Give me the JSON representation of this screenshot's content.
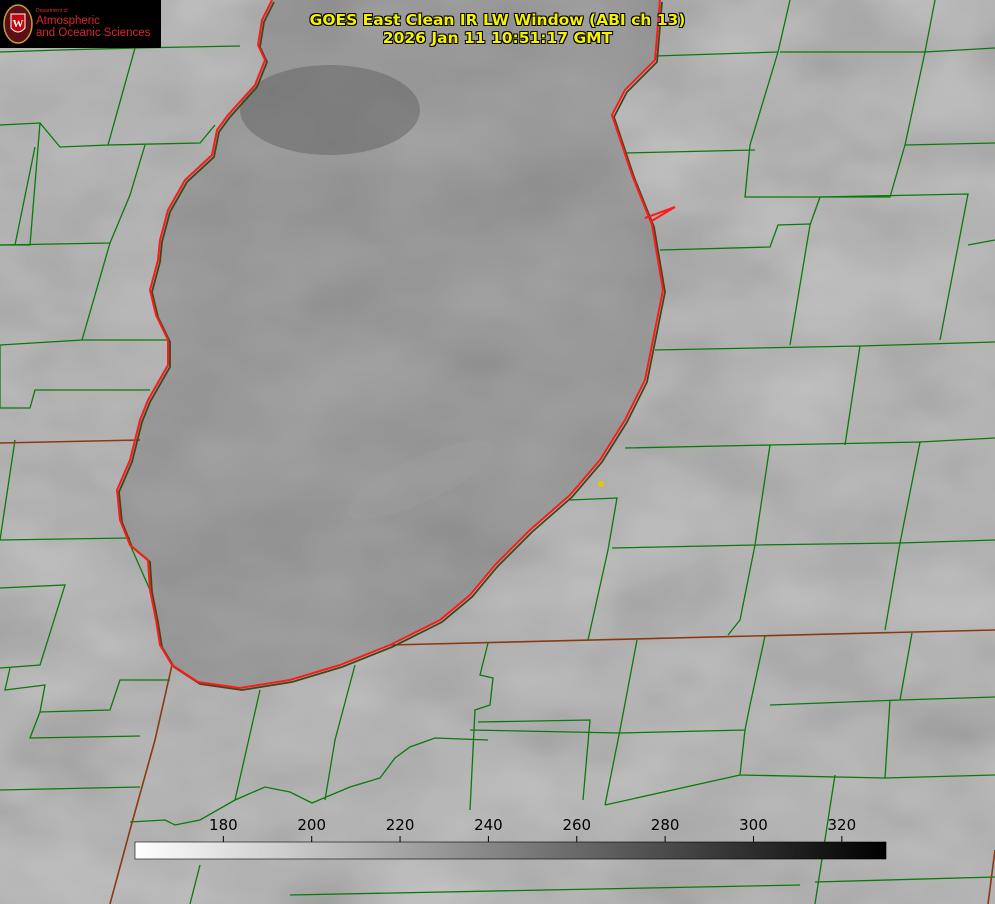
{
  "logo": {
    "dept": "Department of",
    "line1": "Atmospheric",
    "line2": "and Oceanic Sciences",
    "letter": "W"
  },
  "title": {
    "line1": "GOES East Clean IR LW Window (ABI ch 13)",
    "line2": "2026 Jan 11 10:51:17 GMT"
  },
  "colorbar": {
    "min": 160,
    "max": 330,
    "ticks": [
      180,
      200,
      220,
      240,
      260,
      280,
      300,
      320
    ],
    "gradient": [
      "#ffffff",
      "#000000"
    ]
  },
  "colors": {
    "background": "#7a7a7a",
    "county_lines": "#0a7a0a",
    "shoreline": "#ff1a1a",
    "state_lines": "#8a3a10",
    "title_text": "#f5f200",
    "marker": "#e6c800"
  },
  "map": {
    "features": [
      "satellite-ir-imagery",
      "lake-outline",
      "county-boundaries",
      "state-boundaries",
      "location-marker"
    ]
  }
}
